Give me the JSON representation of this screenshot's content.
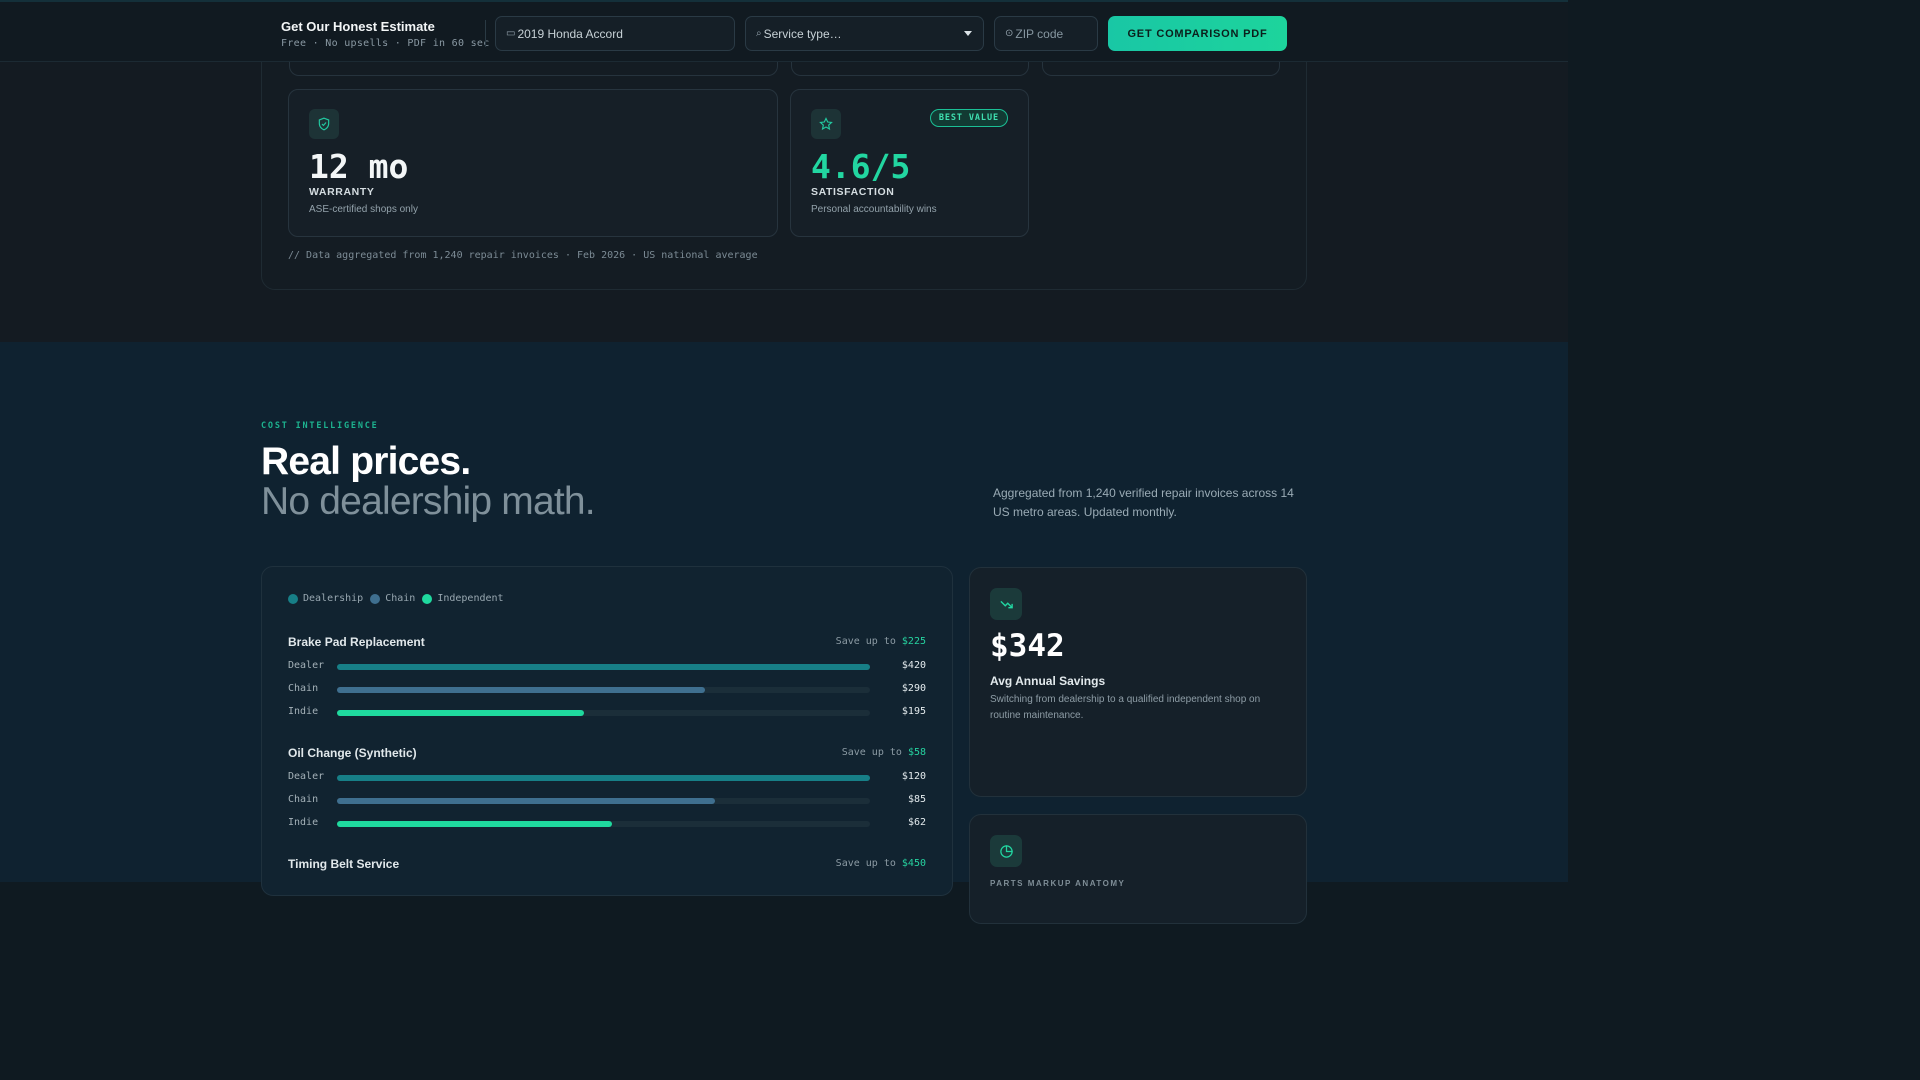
{
  "topbar": {
    "title": "Get Our Honest Estimate",
    "subtitle": "Free · No upsells · PDF in 60 sec",
    "vehicle_value": "2019 Honda Accord",
    "service_placeholder": "Service type…",
    "zip_placeholder": "ZIP code",
    "cta_label": "GET COMPARISON PDF"
  },
  "metrics": [
    {
      "value": "12 mo",
      "label": "WARRANTY",
      "desc": "ASE-certified shops only",
      "icon": "shield-check-icon",
      "accent": "#f3f6f7"
    },
    {
      "value": "4.6/5",
      "label": "SATISFACTION",
      "desc": "Personal accountability wins",
      "icon": "star-icon",
      "badge": "BEST VALUE",
      "accent": "#22d6a1"
    }
  ],
  "footnote": "// Data aggregated from 1,240 repair invoices · Feb 2026 · US national average",
  "section": {
    "eyebrow": "COST INTELLIGENCE",
    "heading": "Real prices.",
    "subheading": "No dealership math.",
    "intro": "Aggregated from 1,240 verified repair invoices across 14 US metro areas. Updated monthly."
  },
  "chart_data": {
    "type": "bar",
    "orientation": "horizontal",
    "legend": [
      "Dealership",
      "Chain",
      "Independent"
    ],
    "colors": {
      "Dealership": "#177f87",
      "Chain": "#3f6f8f",
      "Independent": "#1fd99e"
    },
    "save_prefix": "Save up to",
    "services": [
      {
        "name": "Brake Pad Replacement",
        "save": "$225",
        "rows": [
          {
            "label": "Dealer",
            "value": 420,
            "display": "$420"
          },
          {
            "label": "Chain",
            "value": 290,
            "display": "$290"
          },
          {
            "label": "Indie",
            "value": 195,
            "display": "$195"
          }
        ]
      },
      {
        "name": "Oil Change (Synthetic)",
        "save": "$58",
        "rows": [
          {
            "label": "Dealer",
            "value": 120,
            "display": "$120"
          },
          {
            "label": "Chain",
            "value": 85,
            "display": "$85"
          },
          {
            "label": "Indie",
            "value": 62,
            "display": "$62"
          }
        ]
      },
      {
        "name": "Timing Belt Service",
        "save": "$450",
        "rows": []
      }
    ]
  },
  "savings_card": {
    "value": "$342",
    "label": "Avg Annual Savings",
    "desc": "Switching from dealership to a qualified independent shop on routine maintenance.",
    "icon": "trending-down-icon"
  },
  "second_card": {
    "icon": "pie-chart-icon",
    "peek_label": "PARTS MARKUP ANATOMY"
  }
}
